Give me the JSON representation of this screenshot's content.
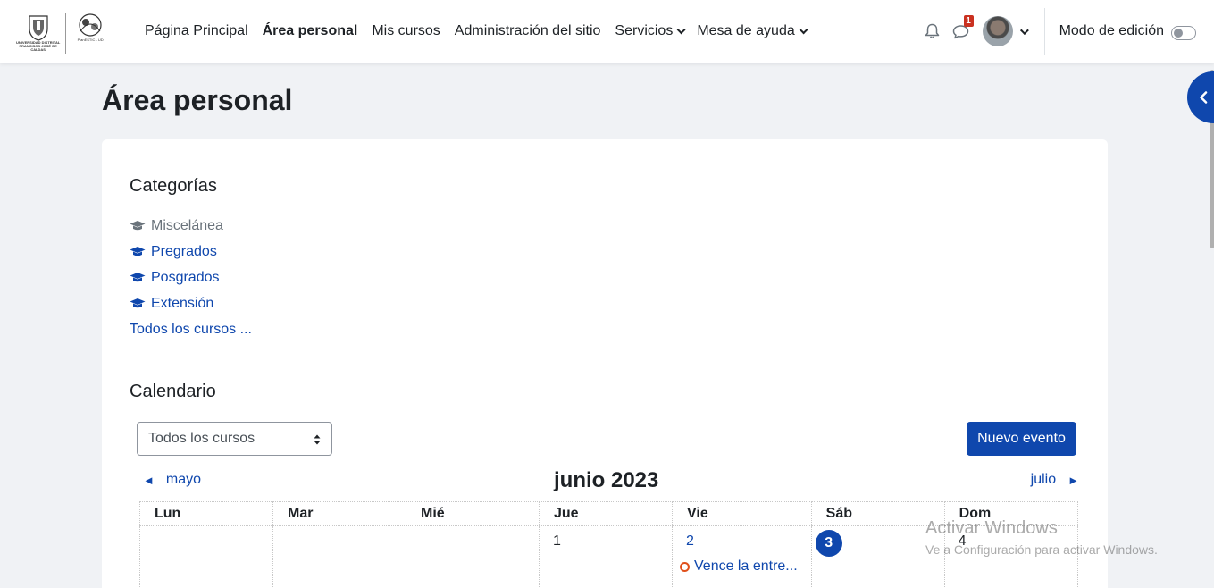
{
  "logo": {
    "left_text": "UNIVERSIDAD DISTRITAL FRANCISCO JOSÉ DE CALDAS",
    "right_text": "PlanESTIC - UD"
  },
  "nav": {
    "items": [
      {
        "label": "Página Principal"
      },
      {
        "label": "Área personal"
      },
      {
        "label": "Mis cursos"
      },
      {
        "label": "Administración del sitio"
      },
      {
        "label": "Servicios"
      },
      {
        "label": "Mesa de ayuda"
      }
    ],
    "messages_count": "1",
    "edit_mode_label": "Modo de edición"
  },
  "page": {
    "title": "Área personal"
  },
  "categories": {
    "title": "Categorías",
    "items": [
      {
        "label": "Miscelánea"
      },
      {
        "label": "Pregrados"
      },
      {
        "label": "Posgrados"
      },
      {
        "label": "Extensión"
      }
    ],
    "all_courses": "Todos los cursos ..."
  },
  "calendar": {
    "title": "Calendario",
    "course_filter": "Todos los cursos",
    "new_event": "Nuevo evento",
    "prev_month": "mayo",
    "next_month": "julio",
    "current_month": "junio 2023",
    "weekdays": [
      "Lun",
      "Mar",
      "Mié",
      "Jue",
      "Vie",
      "Sáb",
      "Dom"
    ],
    "week1": [
      "",
      "",
      "",
      "1",
      "2",
      "3",
      "4"
    ],
    "event_label": "Vence la entre..."
  },
  "watermark": {
    "title": "Activar Windows",
    "subtitle": "Ve a Configuración para activar Windows."
  },
  "colors": {
    "primary": "#0f47ad",
    "badge": "#ca3120",
    "event_dot": "#e0501b"
  }
}
